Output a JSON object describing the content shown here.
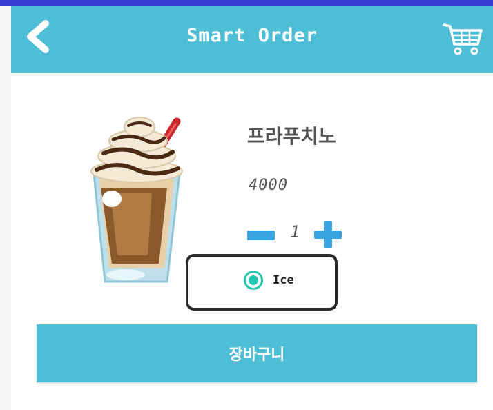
{
  "app_bar": {
    "title": "Smart Order",
    "back_icon": "chevron-left-icon",
    "cart_icon": "shopping-cart-icon",
    "color": "#4ebed6"
  },
  "product": {
    "image": "frappuccino-cup-illustration",
    "name": "프라푸치노",
    "price": "4000",
    "quantity": "1"
  },
  "option": {
    "label": "Ice",
    "selected": true,
    "accent": "#21c8b0"
  },
  "actions": {
    "add_to_cart_label": "장바구니"
  }
}
